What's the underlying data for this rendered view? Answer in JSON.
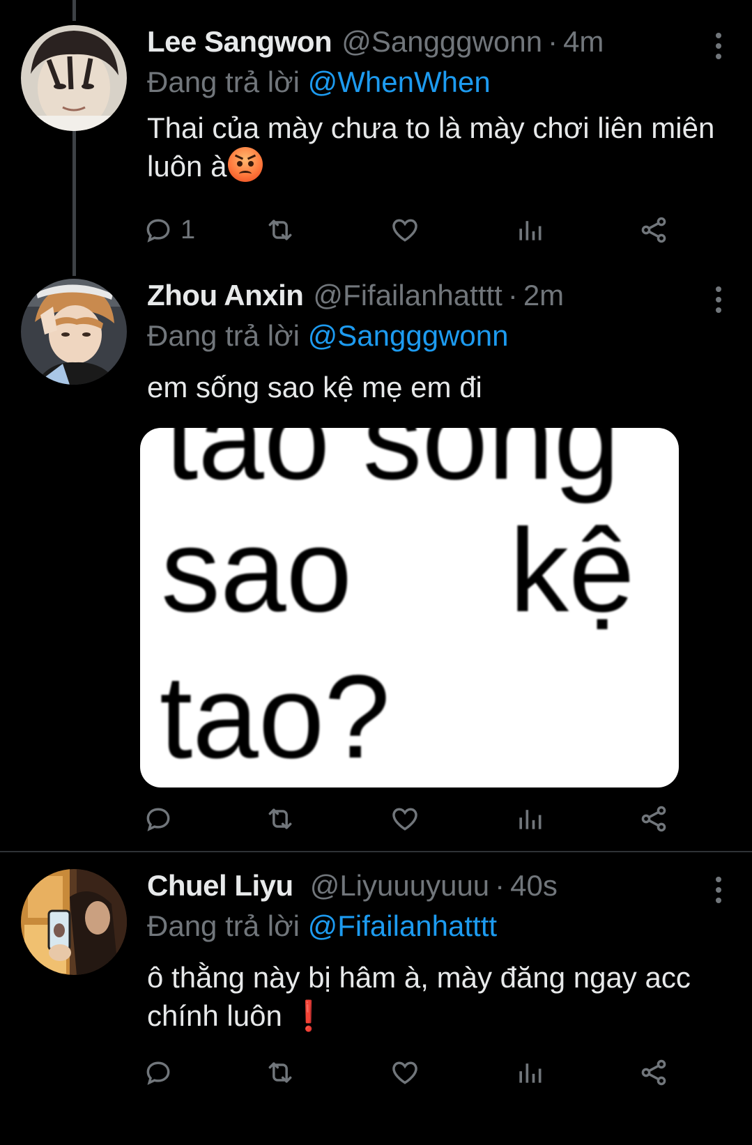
{
  "tweets": [
    {
      "name": "Lee Sangwon",
      "handle": "@Sangggwonn",
      "separator": "·",
      "time": "4m",
      "reply_prefix": "Đang trả lời",
      "reply_to": "@WhenWhen",
      "text": "Thai của mày chưa to là mày chơi liên miên luôn à",
      "emoji": "angry-face",
      "reply_count": "1"
    },
    {
      "name": "Zhou Anxin",
      "handle": "@Fifailanhatttt",
      "separator": "·",
      "time": "2m",
      "reply_prefix": "Đang trả lời",
      "reply_to": "@Sangggwonn",
      "text": "em sống sao kệ mẹ em đi",
      "media_text": {
        "line1": "tao sống",
        "line2a": "sao",
        "line2b": "kệ",
        "line3": "tao?"
      },
      "reply_count": ""
    },
    {
      "name": "Chuel Liyu",
      "handle": "@Liyuuuyuuu",
      "separator": "·",
      "time": "40s",
      "reply_prefix": "Đang trả lời",
      "reply_to": "@Fifailanhatttt",
      "text": "ô thằng này bị hâm à, mày đăng ngay acc chính luôn",
      "emoji": "exclamation",
      "emoji_char": "❗",
      "reply_count": ""
    }
  ],
  "icons": [
    "reply-icon",
    "retweet-icon",
    "like-icon",
    "views-icon",
    "share-icon",
    "more-icon"
  ],
  "colors": {
    "background": "#000000",
    "text": "#e7e9ea",
    "muted": "#71767b",
    "accent": "#1d9bf0",
    "thread_line": "#3d4145"
  }
}
